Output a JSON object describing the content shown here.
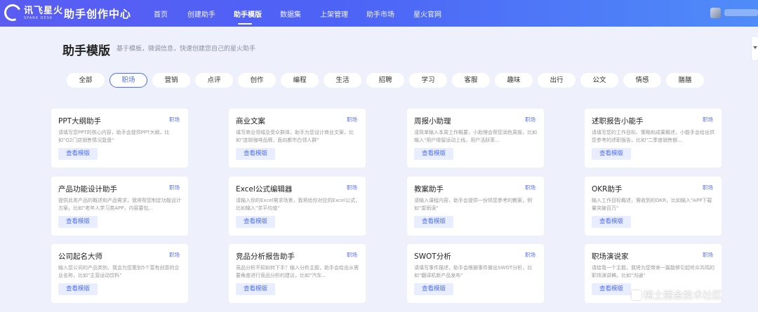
{
  "brand": {
    "logo_cn": "讯飞星火",
    "logo_en": "SPARK DESK",
    "app_title": "助手创作中心"
  },
  "nav": {
    "items": [
      {
        "label": "首页"
      },
      {
        "label": "创建助手"
      },
      {
        "label": "助手模版"
      },
      {
        "label": "数据集"
      },
      {
        "label": "上架管理"
      },
      {
        "label": "助手市场"
      },
      {
        "label": "星火官网"
      }
    ],
    "active": "助手模版"
  },
  "header": {
    "title": "助手模版",
    "subtitle": "基于模板，微调信息，快速创建您自己的星火助手"
  },
  "categories": {
    "items": [
      "全部",
      "职场",
      "营销",
      "点评",
      "创作",
      "编程",
      "生活",
      "招聘",
      "学习",
      "客服",
      "趣味",
      "出行",
      "公文",
      "情感",
      "膳膳"
    ],
    "active": "职场"
  },
  "cards": [
    {
      "title": "PPT大纲助手",
      "tag": "职场",
      "desc": "请填写您PPT的核心内容，助手会提供PPT大纲，比如\"Q2门店销售情况复盘\"",
      "button": "查看模版"
    },
    {
      "title": "商业文案",
      "tag": "职场",
      "desc": "填写商业领域及受众群体，助手为您设计商业文案，比如\"连锁咖啡品牌，面向都市白领人群\"",
      "button": "查看模版"
    },
    {
      "title": "周报小助理",
      "tag": "职场",
      "desc": "请简单输入本周工作概要，小助理会帮您润色周报，比如输入\"用户增留运动上线，用户活跃率...",
      "button": "查看模版"
    },
    {
      "title": "述职报告小能手",
      "tag": "职场",
      "desc": "请填写您的工作目标、策略和成果概述，小能手会给出供您参考的述职报告，比如\"二季度销售额...",
      "button": "查看模版"
    },
    {
      "title": "产品功能设计助手",
      "tag": "职场",
      "desc": "提供此类产品的概述和产品需求，我将帮您制定功能设计方案，比如\"老年人学习类APP，内容要包...",
      "button": "查看模版"
    },
    {
      "title": "Excel公式编辑器",
      "tag": "职场",
      "desc": "请输入你的Excel需求场景，我将给你对应的Excel公式，比如输入\"求平均值\"",
      "button": "查看模版"
    },
    {
      "title": "教案助手",
      "tag": "职场",
      "desc": "请输入课程内容，助手会提供一份供您参考的教案，例如\"雷雨读\"",
      "button": "查看模版"
    },
    {
      "title": "OKR助手",
      "tag": "职场",
      "desc": "输入工作目标概述，需收到的OKR，比如输入\"APP下载量突破百万\"",
      "button": "查看模版"
    },
    {
      "title": "公司起名大师",
      "tag": "职场",
      "desc": "输入您公司的产品类别，我会为您策划5个富有创意的企业名称，比如\"主营运动饮料\"",
      "button": "查看模版"
    },
    {
      "title": "竞品分析报告助手",
      "tag": "职场",
      "desc": "竞品分析不知如何下手？输入分析主题，助手会给出从需要角度进行竞品分析的建议，比如\"汽车...",
      "button": "查看模版"
    },
    {
      "title": "SWOT分析",
      "tag": "职场",
      "desc": "请填写事件描述，助手会根据事件做出SWOT分析，比如\"翻译机新产品发布\"",
      "button": "查看模版"
    },
    {
      "title": "职场演说家",
      "tag": "职场",
      "desc": "请给我一个主题，我将为您带来一篇能够引起听众共鸣的职场演讲稿，比如\"沟通\"",
      "button": "查看模版"
    }
  ],
  "watermark": "稀土掘金技术社区",
  "colors": {
    "accent": "#4e6ef2",
    "nav_gradient_start": "#5a5cf2",
    "nav_gradient_end": "#4f8cf8",
    "page_bg": "#eef1fb",
    "button_bg": "#e8edff"
  },
  "icons": {
    "logo": "spark-logo-icon",
    "avatar": "user-avatar"
  }
}
